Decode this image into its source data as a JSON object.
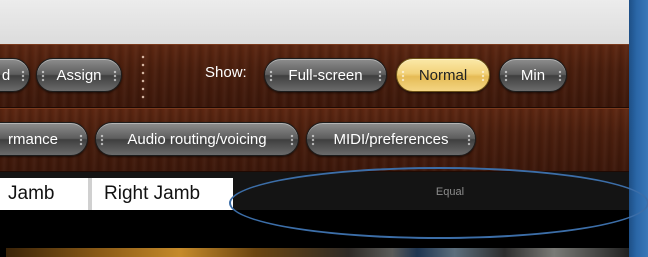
{
  "toolbar_top": {
    "partial_left_label": "d",
    "assign_label": "Assign",
    "show_label": "Show:",
    "fullscreen_label": "Full-screen",
    "normal_label": "Normal",
    "min_label": "Min"
  },
  "toolbar_second": {
    "performance_label": "rmance",
    "audio_label": "Audio routing/voicing",
    "midi_label": "MIDI/preferences"
  },
  "tabs": {
    "left_jamb": "Jamb",
    "right_jamb": "Right Jamb"
  },
  "status": {
    "temperament": "Equal"
  },
  "colors": {
    "active_button": "#f2d27a",
    "annotation": "#3c6ea8",
    "wood": "#4a1e0d"
  }
}
